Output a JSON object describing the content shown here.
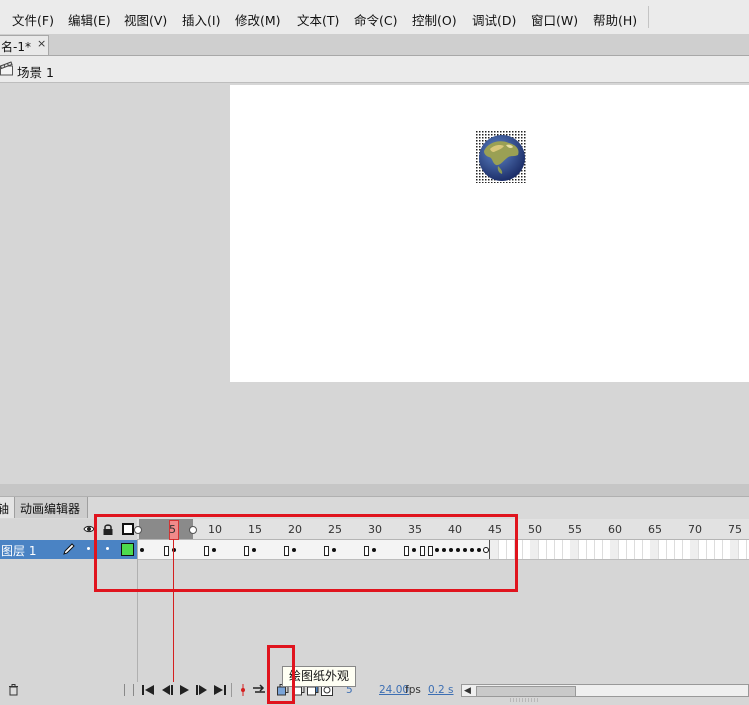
{
  "menu": [
    {
      "label": "文件(F)"
    },
    {
      "label": "编辑(E)"
    },
    {
      "label": "视图(V)"
    },
    {
      "label": "插入(I)"
    },
    {
      "label": "修改(M)"
    },
    {
      "label": "文本(T)"
    },
    {
      "label": "命令(C)"
    },
    {
      "label": "控制(O)"
    },
    {
      "label": "调试(D)"
    },
    {
      "label": "窗口(W)"
    },
    {
      "label": "帮助(H)"
    }
  ],
  "document": {
    "tab_label": "名-1*",
    "close_glyph": "×"
  },
  "breadcrumb": {
    "scene_label": "场景 1",
    "icon": "scene-clapper-icon"
  },
  "panel_tabs": {
    "timeline": "轴",
    "motion_editor": "动画编辑器"
  },
  "timeline": {
    "ruler_numbers": [
      "5",
      "10",
      "15",
      "20",
      "25",
      "30",
      "35",
      "40",
      "45",
      "50",
      "55",
      "60",
      "65",
      "70",
      "75"
    ],
    "current_frame_label": "5",
    "layer": {
      "name": "图层 1"
    }
  },
  "status": {
    "current_frame": "5",
    "fps": "24.00",
    "fps_unit": "fps",
    "elapsed": "0.2 s"
  },
  "tooltip": {
    "text": "绘图纸外观"
  },
  "colors": {
    "highlight_box": "#e0141e",
    "layer_selected": "#4a83c4",
    "playhead": "#d42020",
    "stage": "#ffffff"
  }
}
